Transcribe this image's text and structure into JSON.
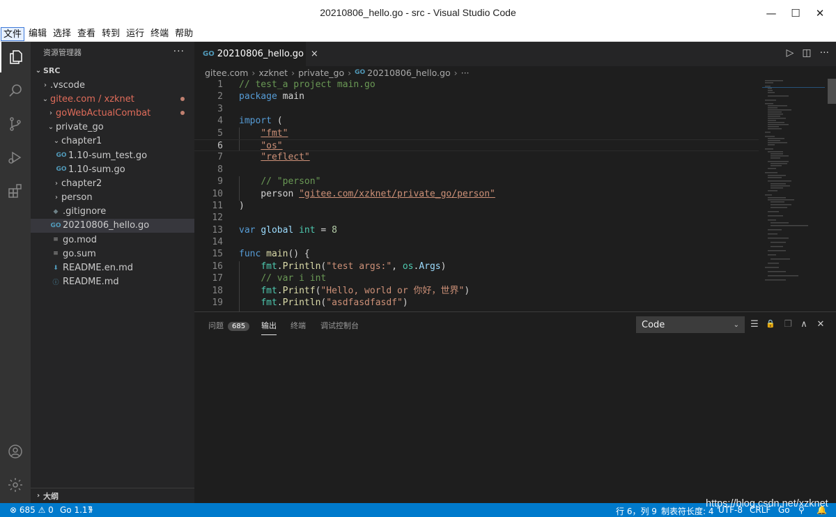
{
  "window": {
    "title": "20210806_hello.go - src - Visual Studio Code",
    "min_glyph": "—",
    "max_glyph": "☐",
    "close_glyph": "✕"
  },
  "menu": [
    "文件",
    "编辑",
    "选择",
    "查看",
    "转到",
    "运行",
    "终端",
    "帮助"
  ],
  "sidebar": {
    "header": "资源管理器",
    "more": "···",
    "section": "SRC",
    "outline": "大纲",
    "tree": [
      {
        "label": ".vscode",
        "chev": "›"
      },
      {
        "label": "gitee.com / xzknet",
        "chev": "⌄"
      },
      {
        "label": "goWebActualCombat",
        "chev": "›"
      },
      {
        "label": "private_go",
        "chev": "⌄"
      },
      {
        "label": "chapter1",
        "chev": "⌄"
      },
      {
        "label": "1.10-sum_test.go",
        "chev": ""
      },
      {
        "label": "1.10-sum.go",
        "chev": ""
      },
      {
        "label": "chapter2",
        "chev": "›"
      },
      {
        "label": "person",
        "chev": "›"
      },
      {
        "label": ".gitignore",
        "chev": ""
      },
      {
        "label": "20210806_hello.go",
        "chev": ""
      },
      {
        "label": "go.mod",
        "chev": ""
      },
      {
        "label": "go.sum",
        "chev": ""
      },
      {
        "label": "README.en.md",
        "chev": ""
      },
      {
        "label": "README.md",
        "chev": ""
      }
    ]
  },
  "editor": {
    "tab": {
      "label": "20210806_hello.go",
      "icon_text": "GO",
      "close": "×"
    },
    "actions": {
      "run": "▷",
      "split": "◫",
      "more": "···"
    },
    "breadcrumb": [
      "gitee.com",
      "xzknet",
      "private_go",
      "20210806_hello.go",
      "···"
    ],
    "breadcrumb_sep": "›",
    "lines": [
      {
        "n": "1",
        "parts": [
          [
            "cm",
            "// test_a project main.go"
          ]
        ]
      },
      {
        "n": "2",
        "parts": [
          [
            "kw",
            "package"
          ],
          [
            "",
            " main"
          ]
        ]
      },
      {
        "n": "3",
        "parts": []
      },
      {
        "n": "4",
        "parts": [
          [
            "kw",
            "import"
          ],
          [
            "",
            " ("
          ]
        ]
      },
      {
        "n": "5",
        "parts": [
          [
            "",
            "    "
          ],
          [
            "str ul",
            "\"fmt\""
          ]
        ]
      },
      {
        "n": "6",
        "parts": [
          [
            "",
            "    "
          ],
          [
            "str ul",
            "\"os\""
          ]
        ]
      },
      {
        "n": "7",
        "parts": [
          [
            "",
            "    "
          ],
          [
            "str ul",
            "\"reflect\""
          ]
        ]
      },
      {
        "n": "8",
        "parts": []
      },
      {
        "n": "9",
        "parts": [
          [
            "",
            "    "
          ],
          [
            "cm",
            "// \"person\""
          ]
        ]
      },
      {
        "n": "10",
        "parts": [
          [
            "",
            "    person "
          ],
          [
            "str ul",
            "\"gitee.com/xzknet/private_go/person\""
          ]
        ]
      },
      {
        "n": "11",
        "parts": [
          [
            "",
            ")"
          ]
        ]
      },
      {
        "n": "12",
        "parts": []
      },
      {
        "n": "13",
        "parts": [
          [
            "kw",
            "var"
          ],
          [
            "",
            " "
          ],
          [
            "var",
            "global"
          ],
          [
            "",
            " "
          ],
          [
            "ty",
            "int"
          ],
          [
            "",
            " = "
          ],
          [
            "num",
            "8"
          ]
        ]
      },
      {
        "n": "14",
        "parts": []
      },
      {
        "n": "15",
        "parts": [
          [
            "kw",
            "func"
          ],
          [
            "",
            " "
          ],
          [
            "fn",
            "main"
          ],
          [
            "",
            "() {"
          ]
        ]
      },
      {
        "n": "16",
        "parts": [
          [
            "",
            "    "
          ],
          [
            "ty",
            "fmt"
          ],
          [
            "",
            "."
          ],
          [
            "fn",
            "Println"
          ],
          [
            "",
            "("
          ],
          [
            "str",
            "\"test args:\""
          ],
          [
            "",
            ", "
          ],
          [
            "ty",
            "os"
          ],
          [
            "",
            "."
          ],
          [
            "var",
            "Args"
          ],
          [
            "",
            ")"
          ]
        ]
      },
      {
        "n": "17",
        "parts": [
          [
            "",
            "    "
          ],
          [
            "cm",
            "// var i int"
          ]
        ]
      },
      {
        "n": "18",
        "parts": [
          [
            "",
            "    "
          ],
          [
            "ty",
            "fmt"
          ],
          [
            "",
            "."
          ],
          [
            "fn",
            "Printf"
          ],
          [
            "",
            "("
          ],
          [
            "str",
            "\"Hello, world or 你好，世界\""
          ],
          [
            "",
            ")"
          ]
        ]
      },
      {
        "n": "19",
        "parts": [
          [
            "",
            "    "
          ],
          [
            "ty",
            "fmt"
          ],
          [
            "",
            "."
          ],
          [
            "fn",
            "Println"
          ],
          [
            "",
            "("
          ],
          [
            "str",
            "\"asdfasdfasdf\""
          ],
          [
            "",
            ")"
          ]
        ]
      }
    ]
  },
  "panel": {
    "tabs": [
      {
        "label": "问题",
        "badge": "685"
      },
      {
        "label": "输出",
        "badge": ""
      },
      {
        "label": "终端",
        "badge": ""
      },
      {
        "label": "调试控制台",
        "badge": ""
      }
    ],
    "select_value": "Code",
    "icons": {
      "clear": "☰",
      "lock": "🔒",
      "copy": "❐",
      "up": "∧",
      "close": "✕"
    }
  },
  "statusbar": {
    "problems": "⊗ 685 ⚠ 0",
    "go_version": "Go 1.17",
    "position": "行 6，列 9",
    "tab_size": "制表符长度: 4",
    "encoding": "UTF-8",
    "eol": "CRLF",
    "language": "Go",
    "watermark": "https://blog.csdn.net/xzknet"
  },
  "colors": {
    "accent": "#007acc",
    "git_modified": "#e06c5a"
  }
}
